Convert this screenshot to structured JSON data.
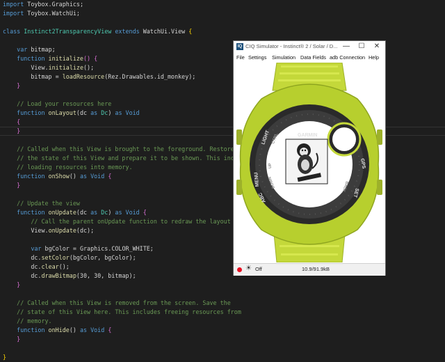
{
  "editor": {
    "lines": [
      {
        "parts": [
          [
            "kw",
            "import"
          ],
          [
            "pn",
            " Toybox.Graphics;"
          ]
        ]
      },
      {
        "parts": [
          [
            "kw",
            "import"
          ],
          [
            "pn",
            " Toybox.WatchUi;"
          ]
        ]
      },
      {
        "parts": []
      },
      {
        "parts": [
          [
            "kw",
            "class"
          ],
          [
            "cls",
            " Instinct2TransparencyView"
          ],
          [
            "kw",
            " extends"
          ],
          [
            "pn",
            " WatchUi.View "
          ],
          [
            "br",
            "{"
          ]
        ]
      },
      {
        "parts": []
      },
      {
        "parts": [
          [
            "pn",
            "    "
          ],
          [
            "kw",
            "var"
          ],
          [
            "pn",
            " bitmap;"
          ]
        ]
      },
      {
        "parts": [
          [
            "pn",
            "    "
          ],
          [
            "kw",
            "function"
          ],
          [
            "fn",
            " initialize"
          ],
          [
            "br2",
            "()"
          ],
          [
            "pn",
            " "
          ],
          [
            "br2",
            "{"
          ]
        ]
      },
      {
        "parts": [
          [
            "pn",
            "        View."
          ],
          [
            "fn",
            "initialize"
          ],
          [
            "pn",
            "();"
          ]
        ]
      },
      {
        "parts": [
          [
            "pn",
            "        bitmap = "
          ],
          [
            "fn",
            "loadResource"
          ],
          [
            "pn",
            "(Rez.Drawables.id_monkey);"
          ]
        ]
      },
      {
        "parts": [
          [
            "pn",
            "    "
          ],
          [
            "br2",
            "}"
          ]
        ]
      },
      {
        "parts": []
      },
      {
        "parts": [
          [
            "cm",
            "    // Load your resources here"
          ]
        ]
      },
      {
        "parts": [
          [
            "pn",
            "    "
          ],
          [
            "kw",
            "function"
          ],
          [
            "fn",
            " onLayout"
          ],
          [
            "pn",
            "(dc "
          ],
          [
            "kw",
            "as"
          ],
          [
            "cls",
            " Dc"
          ],
          [
            "pn",
            ") "
          ],
          [
            "kw",
            "as"
          ],
          [
            "kw",
            " Void"
          ]
        ]
      },
      {
        "parts": [
          [
            "pn",
            "    "
          ],
          [
            "br2",
            "{"
          ]
        ]
      },
      {
        "parts": [
          [
            "pn",
            "    "
          ],
          [
            "br2",
            "}"
          ]
        ]
      },
      {
        "parts": []
      },
      {
        "parts": [
          [
            "cm",
            "    // Called when this View is brought to the foreground. Restore"
          ]
        ]
      },
      {
        "parts": [
          [
            "cm",
            "    // the state of this View and prepare it to be shown. This includes"
          ]
        ]
      },
      {
        "parts": [
          [
            "cm",
            "    // loading resources into memory."
          ]
        ]
      },
      {
        "parts": [
          [
            "pn",
            "    "
          ],
          [
            "kw",
            "function"
          ],
          [
            "fn",
            " onShow"
          ],
          [
            "pn",
            "() "
          ],
          [
            "kw",
            "as"
          ],
          [
            "kw",
            " Void"
          ],
          [
            "pn",
            " "
          ],
          [
            "br2",
            "{"
          ]
        ]
      },
      {
        "parts": [
          [
            "pn",
            "    "
          ],
          [
            "br2",
            "}"
          ]
        ]
      },
      {
        "parts": []
      },
      {
        "parts": [
          [
            "cm",
            "    // Update the view"
          ]
        ]
      },
      {
        "parts": [
          [
            "pn",
            "    "
          ],
          [
            "kw",
            "function"
          ],
          [
            "fn",
            " onUpdate"
          ],
          [
            "pn",
            "(dc "
          ],
          [
            "kw",
            "as"
          ],
          [
            "cls",
            " Dc"
          ],
          [
            "pn",
            ") "
          ],
          [
            "kw",
            "as"
          ],
          [
            "kw",
            " Void"
          ],
          [
            "pn",
            " "
          ],
          [
            "br2",
            "{"
          ]
        ]
      },
      {
        "parts": [
          [
            "cm",
            "        // Call the parent onUpdate function to redraw the layout"
          ]
        ]
      },
      {
        "parts": [
          [
            "pn",
            "        View."
          ],
          [
            "fn",
            "onUpdate"
          ],
          [
            "pn",
            "(dc);"
          ]
        ]
      },
      {
        "parts": []
      },
      {
        "parts": [
          [
            "pn",
            "        "
          ],
          [
            "kw",
            "var"
          ],
          [
            "pn",
            " bgColor = Graphics.COLOR_WHITE;"
          ]
        ]
      },
      {
        "parts": [
          [
            "pn",
            "        dc."
          ],
          [
            "fn",
            "setColor"
          ],
          [
            "pn",
            "(bgColor, bgColor);"
          ]
        ]
      },
      {
        "parts": [
          [
            "pn",
            "        dc."
          ],
          [
            "fn",
            "clear"
          ],
          [
            "pn",
            "();"
          ]
        ]
      },
      {
        "parts": [
          [
            "pn",
            "        dc."
          ],
          [
            "fn",
            "drawBitmap"
          ],
          [
            "pn",
            "(30, 30, bitmap);"
          ]
        ]
      },
      {
        "parts": [
          [
            "pn",
            "    "
          ],
          [
            "br2",
            "}"
          ]
        ]
      },
      {
        "parts": []
      },
      {
        "parts": [
          [
            "cm",
            "    // Called when this View is removed from the screen. Save the"
          ]
        ]
      },
      {
        "parts": [
          [
            "cm",
            "    // state of this View here. This includes freeing resources from"
          ]
        ]
      },
      {
        "parts": [
          [
            "cm",
            "    // memory."
          ]
        ]
      },
      {
        "parts": [
          [
            "pn",
            "    "
          ],
          [
            "kw",
            "function"
          ],
          [
            "fn",
            " onHide"
          ],
          [
            "pn",
            "() "
          ],
          [
            "kw",
            "as"
          ],
          [
            "kw",
            " Void"
          ],
          [
            "pn",
            " "
          ],
          [
            "br2",
            "{"
          ]
        ]
      },
      {
        "parts": [
          [
            "pn",
            "    "
          ],
          [
            "br2",
            "}"
          ]
        ]
      },
      {
        "parts": []
      },
      {
        "parts": [
          [
            "br",
            "}"
          ]
        ]
      }
    ]
  },
  "simulator": {
    "title": "CIQ Simulator - Instinct® 2 / Solar / D...",
    "app_icon": "IQ",
    "window_buttons": {
      "minimize": "—",
      "maximize": "☐",
      "close": "✕"
    },
    "menu": [
      "File",
      "Settings",
      "Simulation",
      "Data Fields",
      "adb Connection",
      "Help"
    ],
    "watch": {
      "labels": {
        "brand": "GARMIN",
        "light": "LIGHT",
        "ctrl": "CTRL",
        "menu": "MENU",
        "abc": "ABC",
        "gps": "GPS",
        "set": "SET",
        "up": "UP",
        "down": "DOWN",
        "back": "BACK"
      },
      "band_color": "#c4d83a",
      "bezel_color": "#a8c22a"
    },
    "status": {
      "off": "Off",
      "memory": "10.9/91.9kB"
    }
  },
  "colors": {
    "editor_bg": "#1e1e1e",
    "keyword": "#569cd6",
    "class": "#4ec9b0",
    "function": "#dcdcaa",
    "comment": "#6a9955"
  }
}
